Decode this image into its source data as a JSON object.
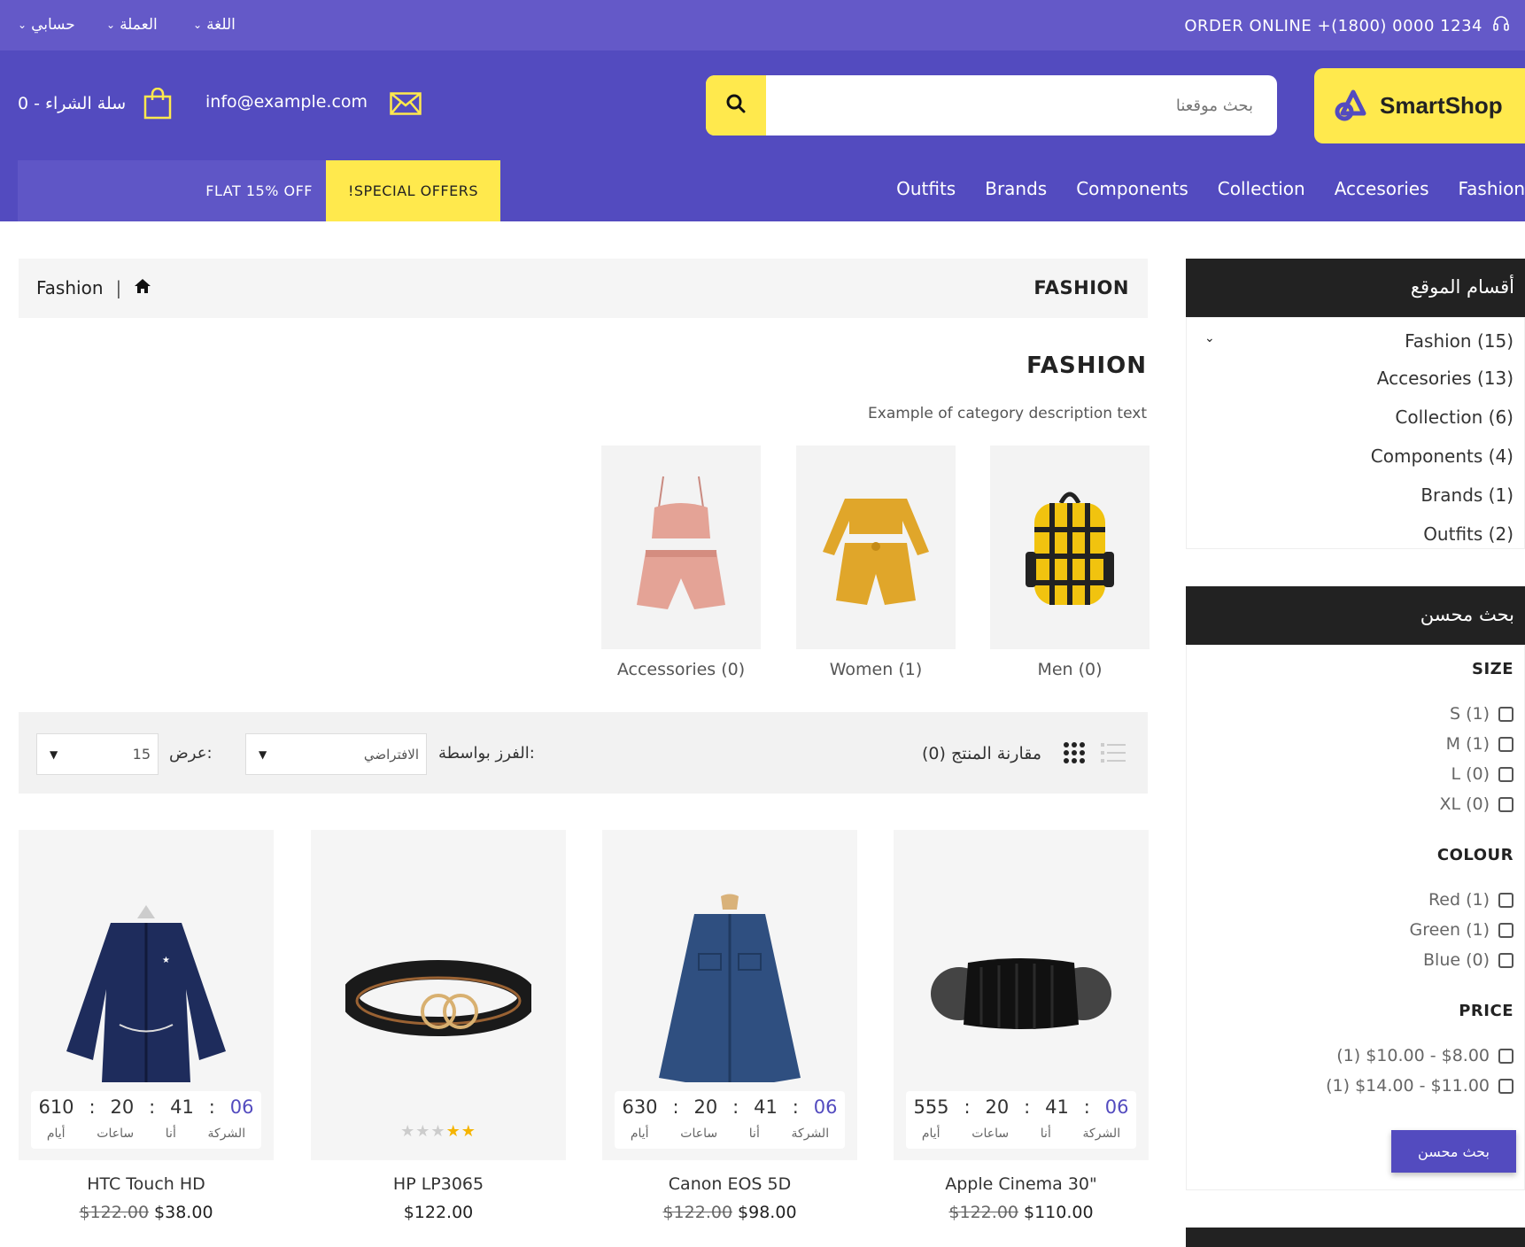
{
  "topbar": {
    "my_account": "حسابي",
    "currency": "العملة",
    "language": "اللغة",
    "order_online": "ORDER ONLINE +(1800) 0000 1234"
  },
  "header": {
    "logo_text": "SmartShop",
    "search_placeholder": "بحث موقعنا",
    "email": "info@example.com",
    "cart_text": "سلة الشراء - 0"
  },
  "nav": {
    "links": [
      "Outfits",
      "Brands",
      "Components",
      "Collection",
      "Accesories",
      "Fashion"
    ],
    "special_offers": "!SPECIAL OFFERS",
    "flat_off": "FLAT 15% OFF"
  },
  "breadcrumb": {
    "current": "Fashion",
    "title": "FASHION"
  },
  "category": {
    "title": "FASHION",
    "description": "Example of category description text",
    "subcategories": [
      {
        "label": "Accessories (0)"
      },
      {
        "label": "Women (1)"
      },
      {
        "label": "Men (0)"
      }
    ]
  },
  "toolbar": {
    "compare": "مقارنة المنتج (0)",
    "sort_label": "الفرز بواسطة:",
    "sort_value": "الافتراضي",
    "show_label": "عرض:",
    "show_value": "15"
  },
  "timer_labels": {
    "company": "الشركة",
    "me": "أنا",
    "hours": "ساعات",
    "days": "أيام"
  },
  "products": [
    {
      "name": "HTC Touch HD",
      "old_price": "$122.00",
      "price": "$38.00",
      "timer": [
        "610",
        "20",
        "41",
        "06"
      ]
    },
    {
      "name": "HP LP3065",
      "old_price": "",
      "price": "$122.00",
      "rating": 2
    },
    {
      "name": "Canon EOS 5D",
      "old_price": "$122.00",
      "price": "$98.00",
      "timer": [
        "630",
        "20",
        "41",
        "06"
      ]
    },
    {
      "name": "Apple Cinema 30\"",
      "old_price": "$122.00",
      "price": "$110.00",
      "timer": [
        "555",
        "20",
        "41",
        "06"
      ]
    }
  ],
  "sidebar": {
    "categories_title": "أقسام الموقع",
    "categories": [
      "Fashion (15)",
      "Accesories (13)",
      "Collection (6)",
      "Components (4)",
      "Brands (1)",
      "Outfits (2)"
    ],
    "filter_title": "بحث محسن",
    "size_title": "SIZE",
    "sizes": [
      "S (1)",
      "M (1)",
      "L (0)",
      "XL (0)"
    ],
    "colour_title": "COLOUR",
    "colours": [
      "Red (1)",
      "Green (1)",
      "Blue (0)"
    ],
    "price_title": "PRICE",
    "prices": [
      "(1) $10.00 - $8.00",
      "(1) $14.00 - $11.00"
    ],
    "filter_button": "بحث محسن"
  },
  "colors": {
    "primary": "#534bbf",
    "topbar": "#6459c8",
    "accent": "#ffe94d",
    "dark": "#222222",
    "timer_accent": "#534bbf"
  }
}
